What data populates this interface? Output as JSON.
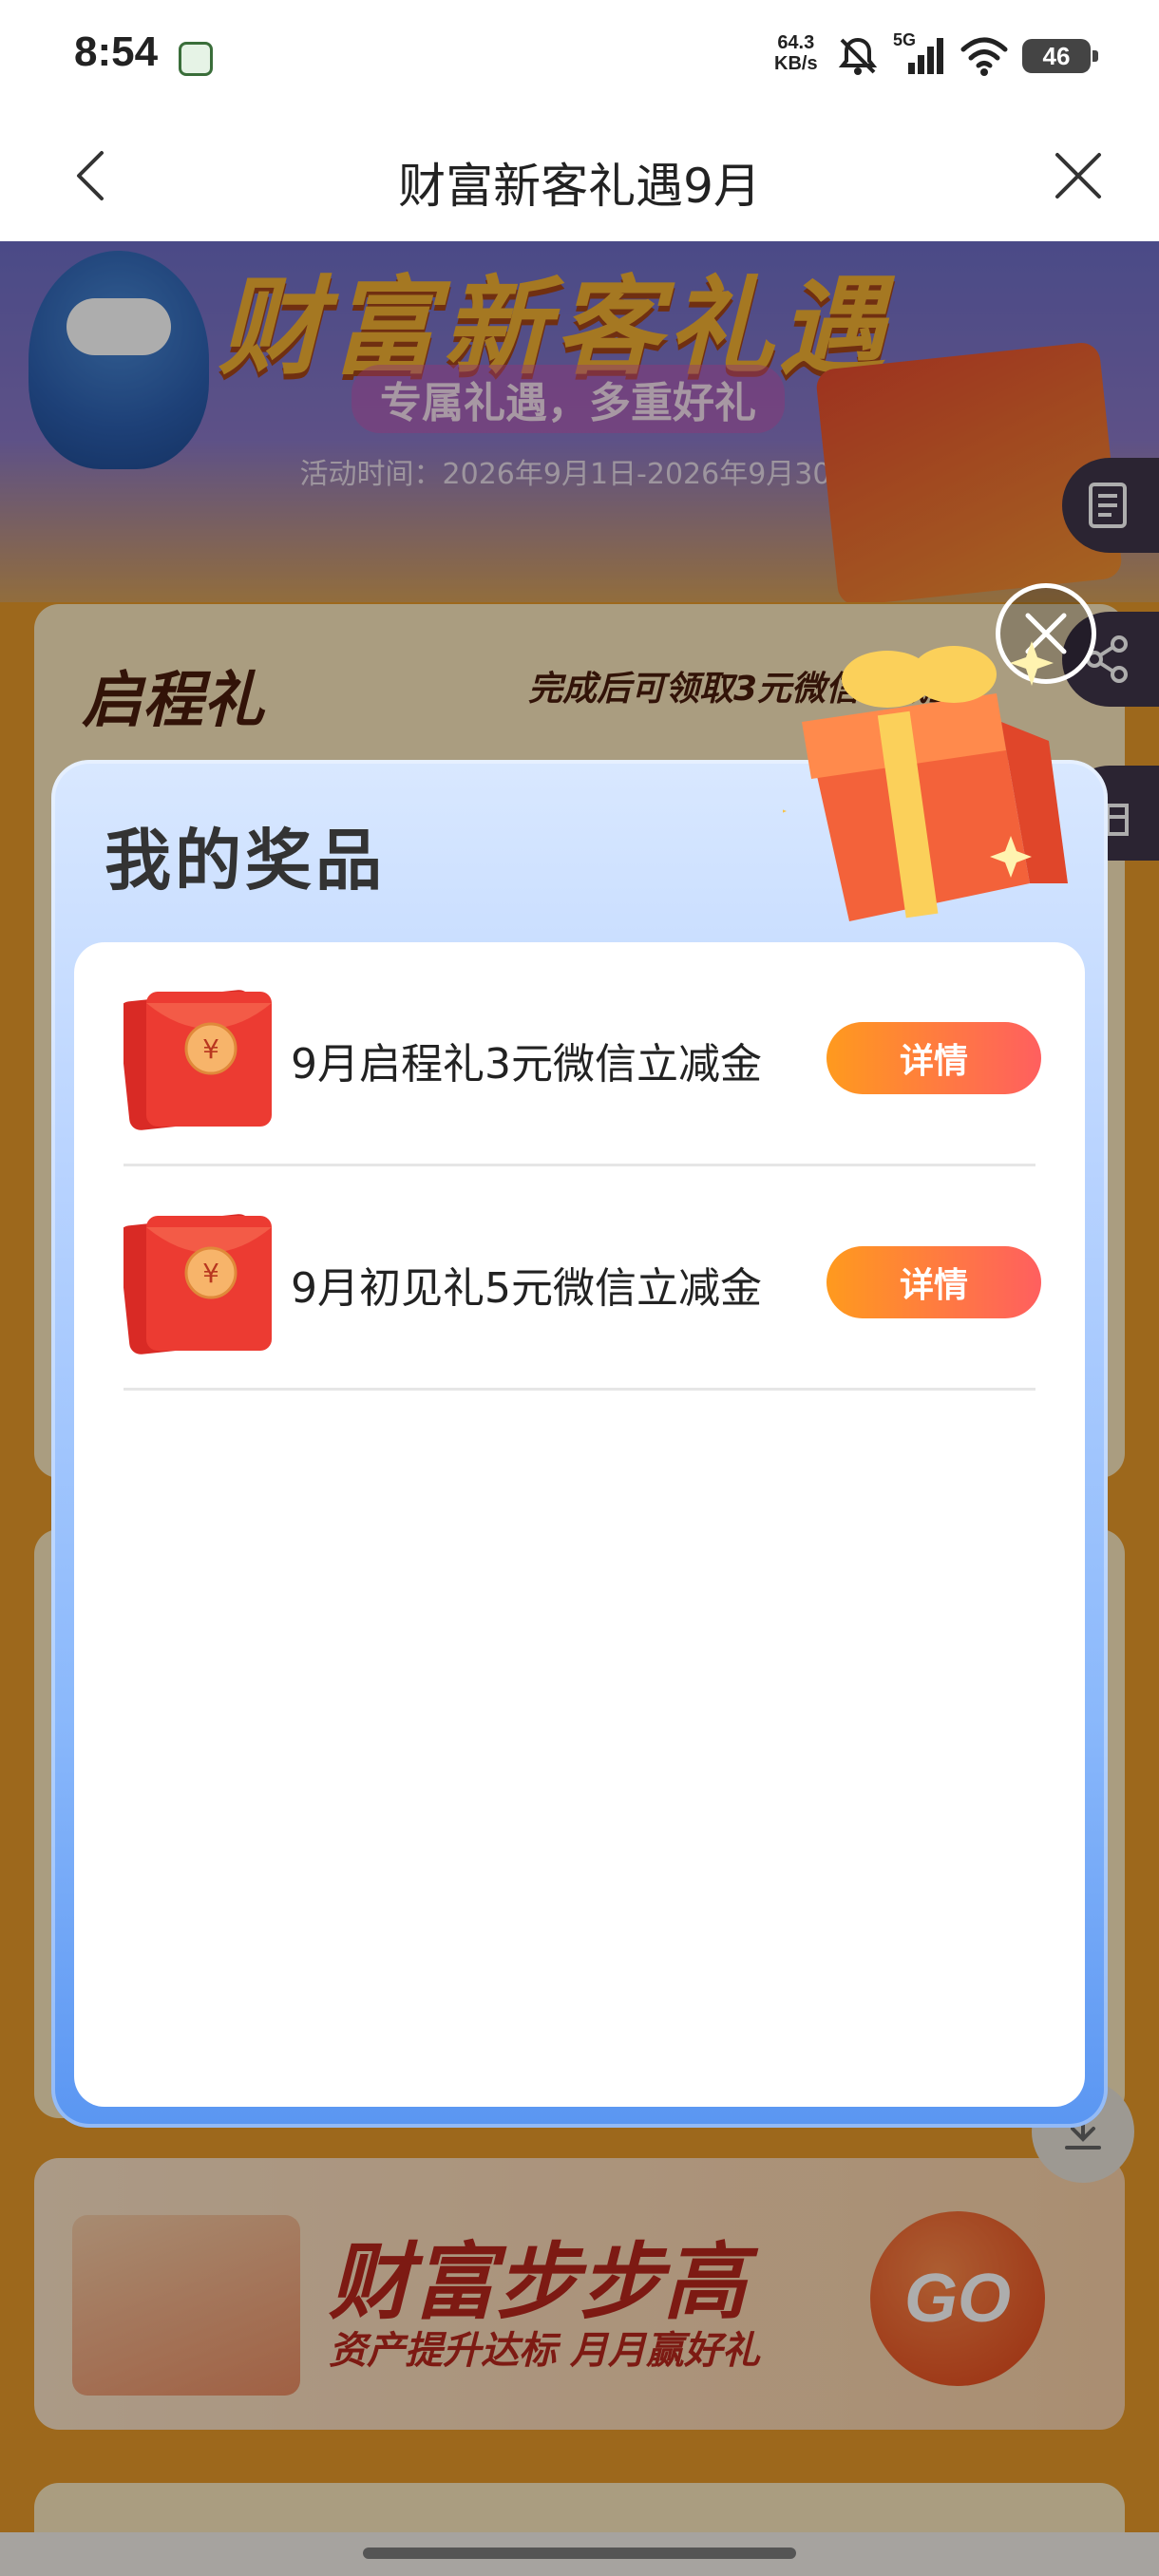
{
  "status_bar": {
    "time": "8:54",
    "net_speed_value": "64.3",
    "net_speed_unit": "KB/s",
    "signal_label": "5G",
    "battery": "46"
  },
  "title_bar": {
    "title": "财富新客礼遇9月",
    "back_icon": "chevron-left-icon",
    "close_icon": "close-icon"
  },
  "background_page": {
    "hero_title": "财富新客礼遇",
    "hero_subtitle": "专属礼遇，多重好礼",
    "hero_date": "活动时间：2026年9月1日-2026年9月30日",
    "qicheng_title": "启程礼",
    "qicheng_note": "完成后可领取3元微信立减金",
    "bubu_title": "财富步步高",
    "bubu_subtitle": "资产提升达标 月月赢好礼",
    "go_label": "GO"
  },
  "modal": {
    "title": "我的奖品",
    "prizes": [
      {
        "name": "9月启程礼3元微信立减金",
        "button_label": "详情"
      },
      {
        "name": "9月初见礼5元微信立减金",
        "button_label": "详情"
      }
    ]
  },
  "colors": {
    "accent_orange": "#ff9a1e",
    "accent_pink": "#ff5f5f",
    "envelope_red": "#e8332c",
    "modal_blue": "#5a96f2"
  }
}
